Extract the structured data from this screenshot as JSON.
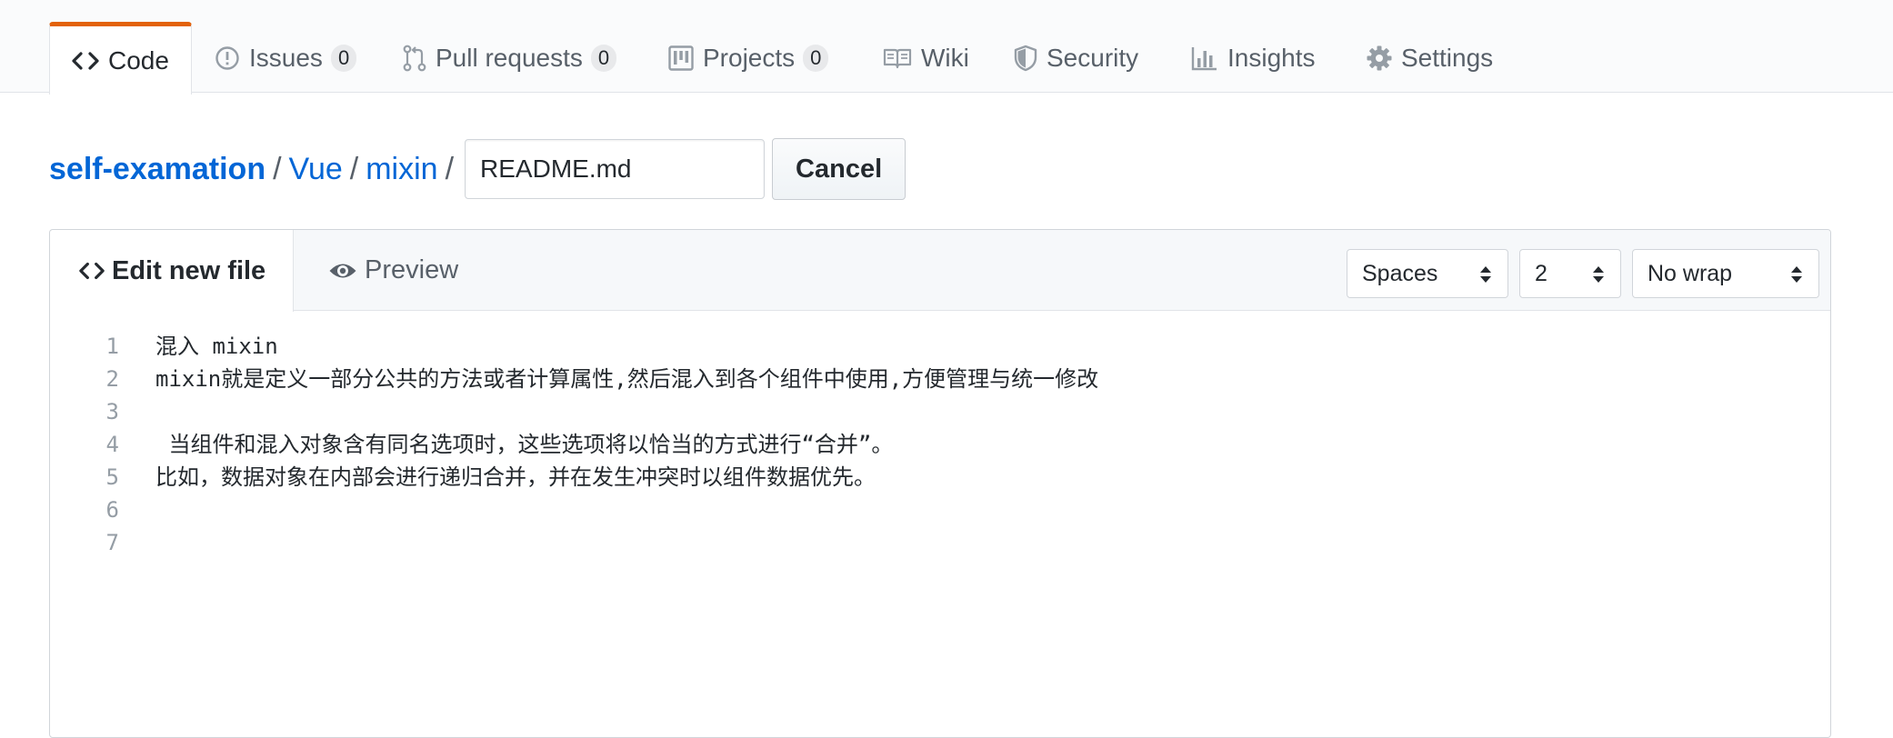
{
  "reponav": {
    "tabs": [
      {
        "label": "Code",
        "icon": "code-icon",
        "selected": true
      },
      {
        "label": "Issues",
        "icon": "issue-opened-icon",
        "count": "0"
      },
      {
        "label": "Pull requests",
        "icon": "git-pull-request-icon",
        "count": "0"
      },
      {
        "label": "Projects",
        "icon": "project-icon",
        "count": "0"
      },
      {
        "label": "Wiki",
        "icon": "book-icon"
      },
      {
        "label": "Security",
        "icon": "shield-icon"
      },
      {
        "label": "Insights",
        "icon": "graph-icon"
      },
      {
        "label": "Settings",
        "icon": "gear-icon"
      }
    ],
    "accent_color": "#e36209"
  },
  "breadcrumb": {
    "root": "self-examation",
    "sep": "/",
    "parts": [
      "Vue",
      "mixin"
    ],
    "filename_value": "README.md",
    "cancel_label": "Cancel",
    "link_color": "#0366d6"
  },
  "editor": {
    "tabs": {
      "edit": "Edit new file",
      "preview": "Preview"
    },
    "indent_mode": "Spaces",
    "indent_size": "2",
    "wrap_mode": "No wrap",
    "lines": [
      {
        "num": "1",
        "text": "混入 mixin"
      },
      {
        "num": "2",
        "text": "mixin就是定义一部分公共的方法或者计算属性,然后混入到各个组件中使用,方便管理与统一修改"
      },
      {
        "num": "3",
        "text": ""
      },
      {
        "num": "4",
        "text": " 当组件和混入对象含有同名选项时，这些选项将以恰当的方式进行“合并”。"
      },
      {
        "num": "5",
        "text": "比如，数据对象在内部会进行递归合并，并在发生冲突时以组件数据优先。"
      },
      {
        "num": "6",
        "text": ""
      },
      {
        "num": "7",
        "text": ""
      }
    ]
  }
}
